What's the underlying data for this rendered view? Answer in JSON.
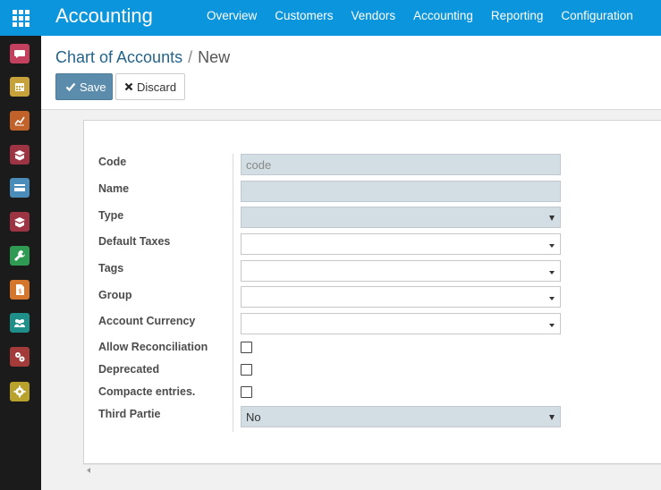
{
  "app": {
    "title": "Accounting"
  },
  "top_nav": [
    "Overview",
    "Customers",
    "Vendors",
    "Accounting",
    "Reporting",
    "Configuration"
  ],
  "sidebar": {
    "items": [
      {
        "icon": "discuss-icon",
        "color": "#c3405f"
      },
      {
        "icon": "calendar-icon",
        "color": "#c7a23a"
      },
      {
        "icon": "dashboard-chart-icon",
        "color": "#c0622a"
      },
      {
        "icon": "inventory-box-icon",
        "color": "#9c3443"
      },
      {
        "icon": "invoicing-card-icon",
        "color": "#4a8dbb"
      },
      {
        "icon": "purchase-box-icon",
        "color": "#9c3443"
      },
      {
        "icon": "settings-wrench-icon",
        "color": "#2f9a52"
      },
      {
        "icon": "expense-document-icon",
        "color": "#d4762b"
      },
      {
        "icon": "employees-icon",
        "color": "#1f8f8a"
      },
      {
        "icon": "manufacturing-icon",
        "color": "#a33b3b"
      },
      {
        "icon": "settings-gear-icon",
        "color": "#b8a22c"
      }
    ]
  },
  "breadcrumb": {
    "parent": "Chart of Accounts",
    "separator": "/",
    "current": "New"
  },
  "buttons": {
    "save": "Save",
    "discard": "Discard"
  },
  "form": {
    "code": {
      "label": "Code",
      "placeholder": "code",
      "value": ""
    },
    "name": {
      "label": "Name",
      "value": ""
    },
    "type": {
      "label": "Type",
      "value": ""
    },
    "default_taxes": {
      "label": "Default Taxes",
      "value": ""
    },
    "tags": {
      "label": "Tags",
      "value": ""
    },
    "group": {
      "label": "Group",
      "value": ""
    },
    "account_currency": {
      "label": "Account Currency",
      "value": ""
    },
    "allow_reconciliation": {
      "label": "Allow Reconciliation",
      "checked": false
    },
    "deprecated": {
      "label": "Deprecated",
      "checked": false
    },
    "compacte_entries": {
      "label": "Compacte entries.",
      "checked": false
    },
    "third_partie": {
      "label": "Third Partie",
      "value": "No"
    }
  },
  "colors": {
    "brand": "#0b95dc",
    "save_button": "#5c8cab",
    "required_field": "#d2dee3"
  }
}
